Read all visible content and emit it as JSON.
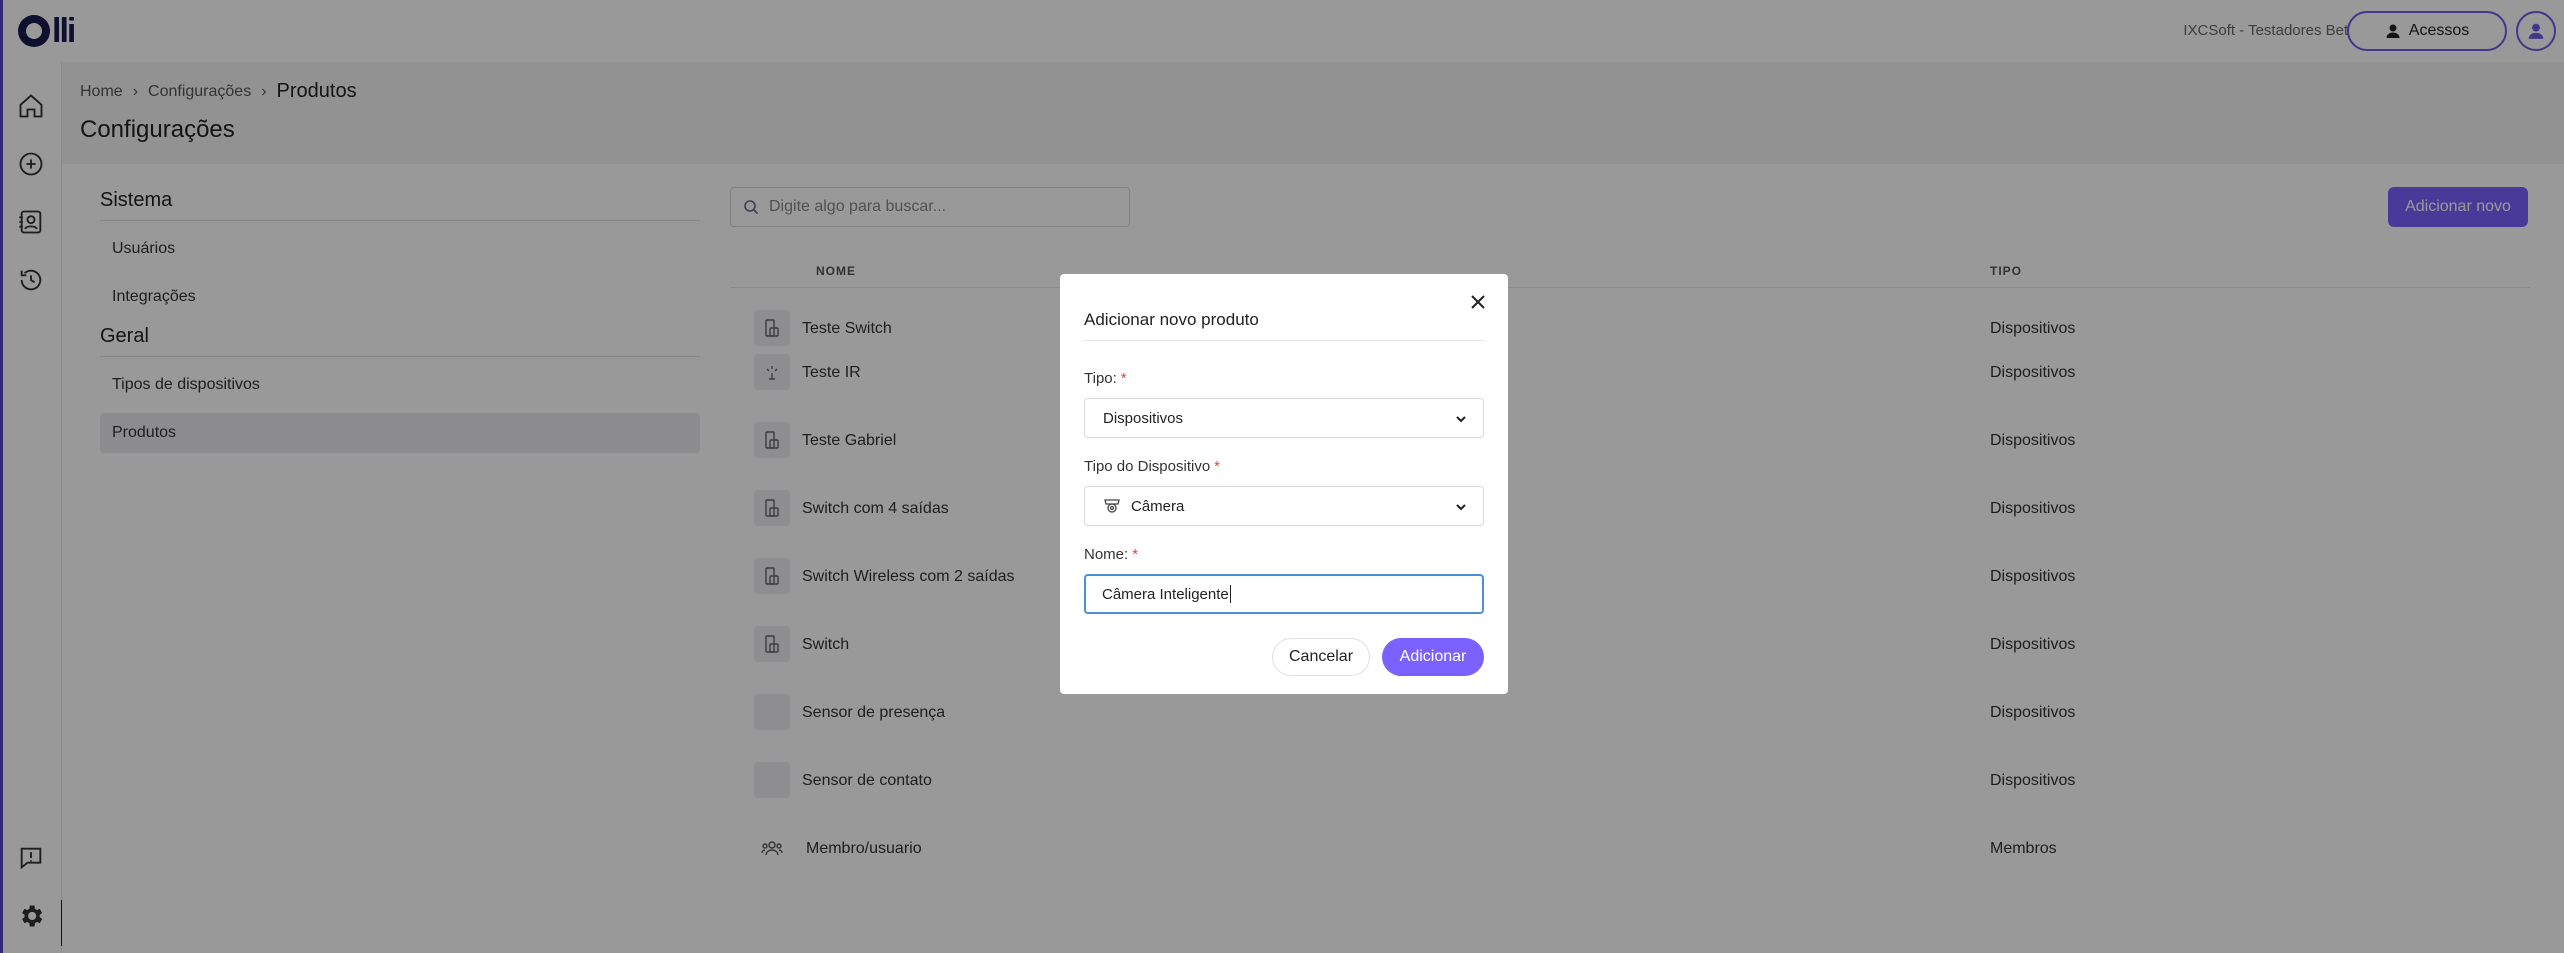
{
  "topbar": {
    "logo_text": "lli",
    "org_name": "IXCSoft - Testadores Betas",
    "access_label": "Acessos"
  },
  "sidebar": {
    "items": [
      "home-icon",
      "add-circle-icon",
      "contacts-icon",
      "history-icon",
      "feedback-icon",
      "settings-icon"
    ],
    "active": "settings-icon"
  },
  "breadcrumb": {
    "home": "Home",
    "config": "Configurações",
    "current": "Produtos"
  },
  "page_title": "Configurações",
  "settings_nav": {
    "sections": [
      {
        "title": "Sistema",
        "items": [
          "Usuários",
          "Integrações"
        ]
      },
      {
        "title": "Geral",
        "items": [
          "Tipos de dispositivos",
          "Produtos"
        ]
      }
    ],
    "active_item": "Produtos"
  },
  "search": {
    "placeholder": "Digite algo para buscar..."
  },
  "add_new_label": "Adicionar novo",
  "table": {
    "headers": {
      "name": "NOME",
      "type": "TIPO"
    },
    "rows": [
      {
        "name": "Teste Switch",
        "type": "Dispositivos",
        "icon": "switch-icon"
      },
      {
        "name": "Teste IR",
        "type": "Dispositivos",
        "icon": "ir-icon"
      },
      {
        "name": "Teste Gabriel",
        "type": "Dispositivos",
        "icon": "switch-icon"
      },
      {
        "name": "Switch com 4 saídas",
        "type": "Dispositivos",
        "icon": "switch-icon"
      },
      {
        "name": "Switch Wireless com 2 saídas",
        "type": "Dispositivos",
        "icon": "switch-icon"
      },
      {
        "name": "Switch",
        "type": "Dispositivos",
        "icon": "switch-icon"
      },
      {
        "name": "Sensor de presença",
        "type": "Dispositivos",
        "icon": ""
      },
      {
        "name": "Sensor de contato",
        "type": "Dispositivos",
        "icon": ""
      },
      {
        "name": "Membro/usuario",
        "type": "Membros",
        "icon": "members-icon"
      }
    ]
  },
  "modal": {
    "title": "Adicionar novo produto",
    "tipo_label": "Tipo:",
    "tipo_value": "Dispositivos",
    "device_type_label": "Tipo do Dispositivo",
    "device_type_value": "Câmera",
    "nome_label": "Nome:",
    "nome_value": "Câmera Inteligente",
    "required_mark": "*",
    "cancel_label": "Cancelar",
    "add_label": "Adicionar"
  },
  "colors": {
    "accent": "#7b61ff",
    "brand": "#1a1a4e",
    "focus": "#4a90d9",
    "required": "#e0463e"
  }
}
